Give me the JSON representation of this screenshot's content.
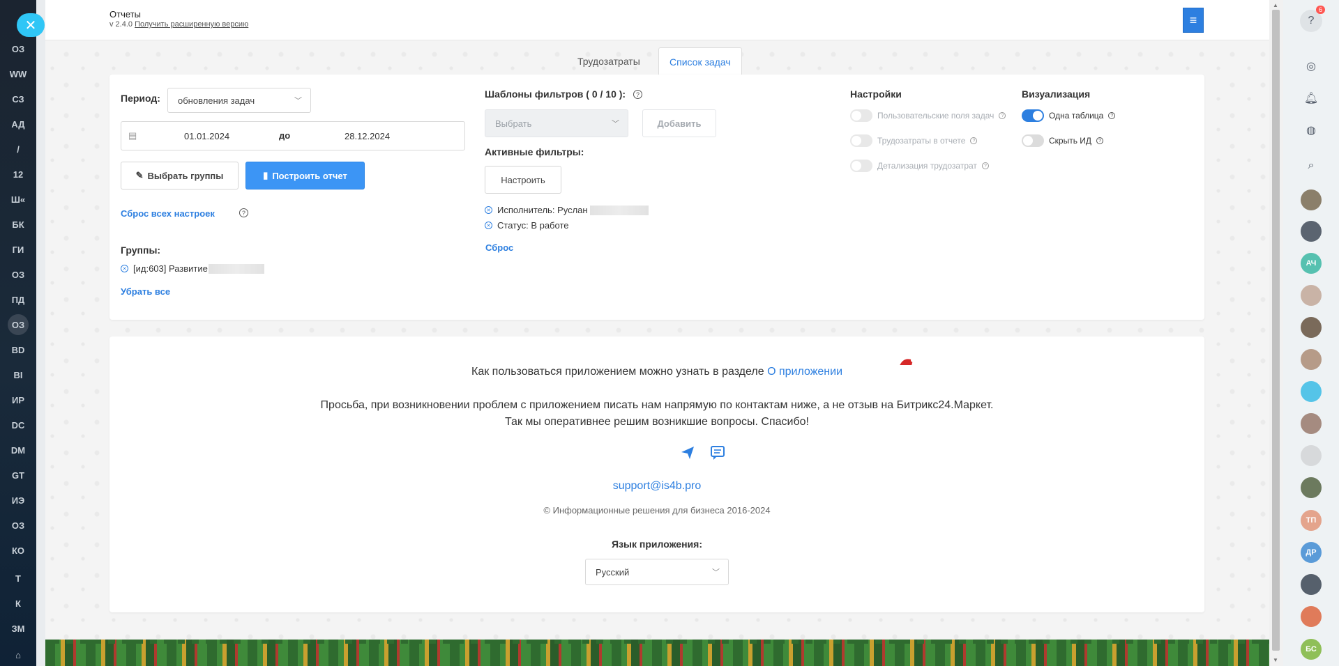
{
  "left_rail": {
    "items": [
      "ОЗ",
      "WW",
      "СЗ",
      "АД",
      "/",
      "12",
      "Ш«",
      "БК",
      "ГИ",
      "ОЗ",
      "ПД",
      "ОЗ",
      "BD",
      "BI",
      "ИР",
      "DC",
      "DM",
      "GT",
      "ИЭ",
      "ОЗ",
      "КО",
      "Т",
      "К",
      "ЗМ"
    ],
    "active_index": 11
  },
  "header": {
    "title": "Отчеты",
    "version": "v 2.4.0",
    "upgrade_link": "Получить расширенную версию"
  },
  "tabs": [
    {
      "label": "Трудозатраты",
      "active": false
    },
    {
      "label": "Список задач",
      "active": true
    }
  ],
  "period": {
    "label": "Период:",
    "select_value": "обновления задач",
    "date_from": "01.01.2024",
    "date_to_label": "до",
    "date_to": "28.12.2024"
  },
  "buttons": {
    "select_groups": "Выбрать группы",
    "build_report": "Построить отчет",
    "configure": "Настроить",
    "add": "Добавить"
  },
  "reset_all": "Сброс всех настроек",
  "groups": {
    "label": "Группы:",
    "items": [
      "[ид:603] Развитие"
    ],
    "remove_all": "Убрать все"
  },
  "filter_templates": {
    "label": "Шаблоны фильтров ( 0 / 10 ):",
    "select_placeholder": "Выбрать"
  },
  "active_filters": {
    "label": "Активные фильтры:",
    "items": [
      "Исполнитель: Руслан",
      "Статус: В работе"
    ],
    "reset": "Сброс"
  },
  "settings": {
    "label": "Настройки",
    "toggles": [
      {
        "label": "Пользовательские поля задач",
        "on": false
      },
      {
        "label": "Трудозатраты в отчете",
        "on": false
      },
      {
        "label": "Детализация трудозатрат",
        "on": false
      }
    ]
  },
  "visualization": {
    "label": "Визуализация",
    "toggles": [
      {
        "label": "Одна таблица",
        "on": true
      },
      {
        "label": "Скрыть ИД",
        "on": false
      }
    ]
  },
  "footer": {
    "howto_text": "Как пользоваться приложением можно узнать в разделе",
    "howto_link": "О приложении",
    "notice_line1": "Просьба, при возникновении проблем с приложением писать нам напрямую по контактам ниже, а не отзыв на Битрикс24.Маркет.",
    "notice_line2": "Так мы оперативнее решим возникшие вопросы. Спасибо!",
    "email": "support@is4b.pro",
    "copyright": "© Информационные решения для бизнеса 2016-2024",
    "language_label": "Язык приложения:",
    "language_value": "Русский"
  },
  "right_rail": {
    "notification_count": "6",
    "avatars": [
      "",
      "",
      "АЧ",
      "",
      "",
      "",
      "",
      "",
      "",
      "",
      "ТП",
      "ДР",
      "",
      "",
      "БС"
    ]
  },
  "colors": {
    "accent": "#2d7fe0",
    "primary_button": "#3c95f5",
    "close_button": "#2fc6f6"
  }
}
